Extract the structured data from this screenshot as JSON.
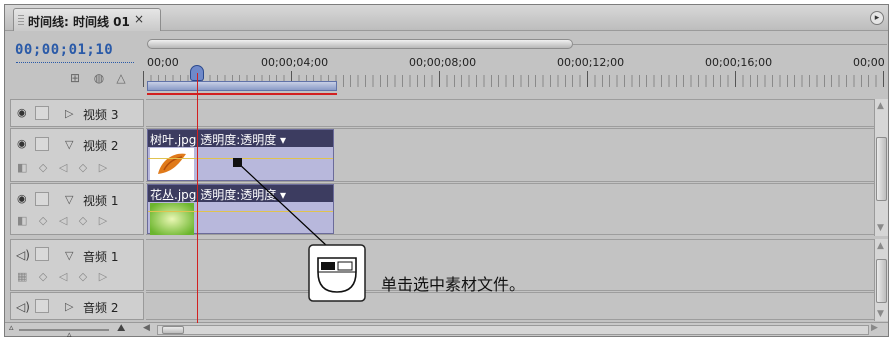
{
  "panel": {
    "tab_title": "时间线: 时间线 01",
    "tab_close": "×",
    "menu_icon": "circle-arrow-icon"
  },
  "timecode": "00;00;01;10",
  "ruler": {
    "labels": [
      "00;00",
      "00;00;04;00",
      "00;00;08;00",
      "00;00;12;00",
      "00;00;16;00",
      "00;00"
    ]
  },
  "tracks": {
    "video": [
      {
        "name": "视频 3",
        "expanded": false
      },
      {
        "name": "视频 2",
        "expanded": true
      },
      {
        "name": "视频 1",
        "expanded": true
      }
    ],
    "audio": [
      {
        "name": "音频 1",
        "expanded": true
      },
      {
        "name": "音频 2",
        "expanded": false
      }
    ]
  },
  "clips": [
    {
      "label": "树叶.jpg 透明度:透明度 ▾",
      "track": "视频 2"
    },
    {
      "label": "花丛.jpg 透明度:透明度 ▾",
      "track": "视频 1"
    }
  ],
  "callout": {
    "text": "单击选中素材文件。",
    "icon": "mouse-left-click-icon"
  },
  "colors": {
    "timecode": "#2a5aa8",
    "clip_head": "#3c3c60",
    "clip_body": "#b8b8dc",
    "playhead": "#d22020"
  }
}
